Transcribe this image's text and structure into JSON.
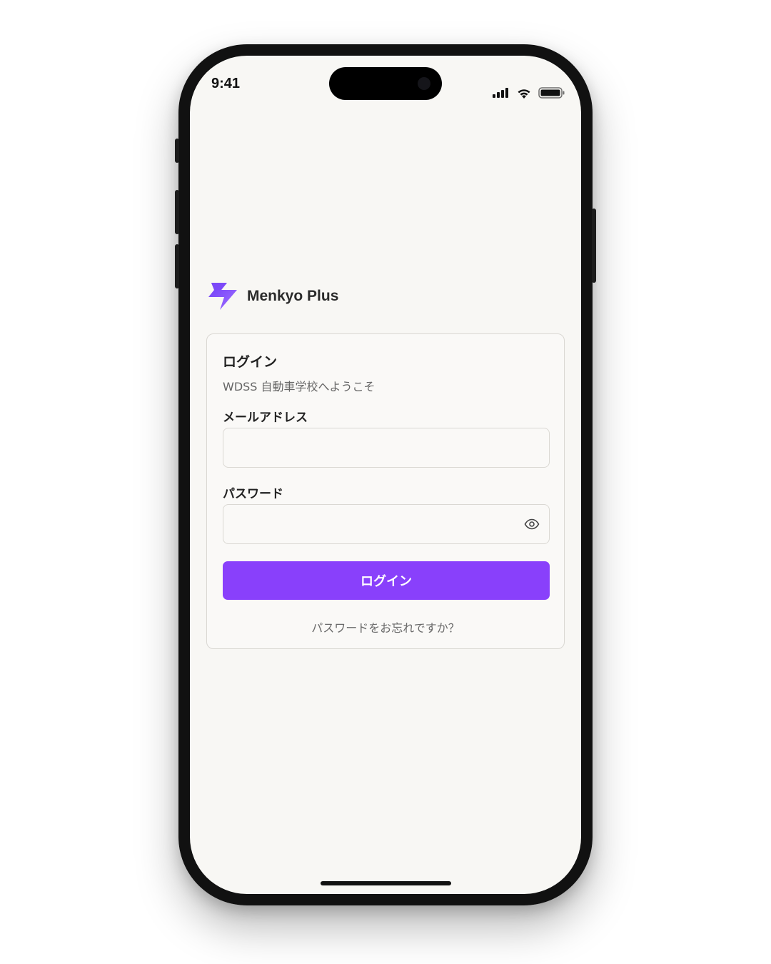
{
  "status_bar": {
    "time": "9:41",
    "icons": [
      "signal-icon",
      "wifi-icon",
      "battery-icon"
    ]
  },
  "brand": {
    "name": "Menkyo Plus",
    "logo_icon": "lightning-bolt-logo",
    "logo_colors": [
      "#6f3cf7",
      "#a070ff"
    ]
  },
  "login_card": {
    "title": "ログイン",
    "subtitle": "WDSS 自動車学校へようこそ",
    "email": {
      "label": "メールアドレス",
      "value": "",
      "placeholder": ""
    },
    "password": {
      "label": "パスワード",
      "value": "",
      "placeholder": "",
      "toggle_icon": "eye-icon"
    },
    "submit_label": "ログイン",
    "forgot_link": "パスワードをお忘れですか？"
  },
  "colors": {
    "accent": "#8940fb",
    "background": "#f8f7f4",
    "text": "#222222",
    "muted_text": "#666666"
  }
}
